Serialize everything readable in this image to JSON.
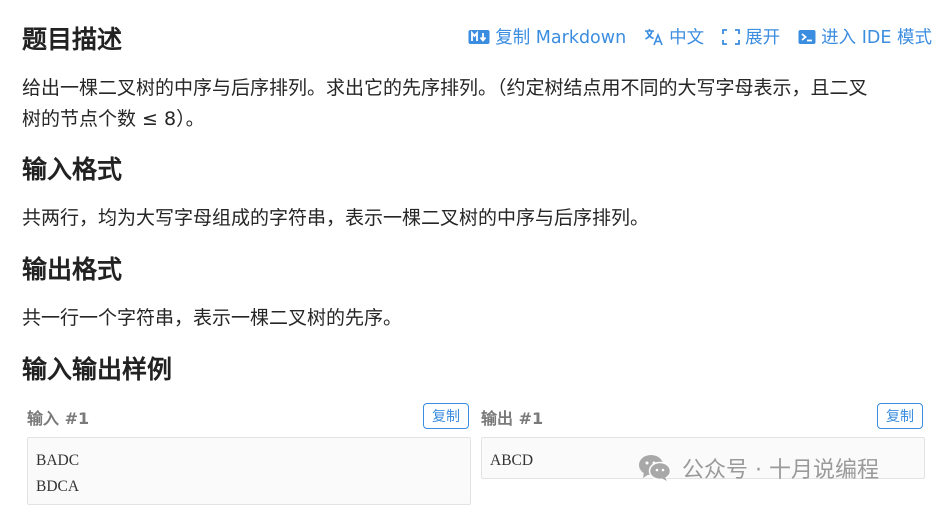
{
  "header": {
    "title": "题目描述",
    "actions": {
      "copy_markdown": "复制 Markdown",
      "language": "中文",
      "expand": "展开",
      "ide_mode": "进入 IDE 模式"
    }
  },
  "description": {
    "line1": "给出一棵二叉树的中序与后序排列。求出它的先序排列。（约定树结点用不同的大写字母表示，且二叉",
    "line2": "树的节点个数 ≤ 8）。"
  },
  "input_format": {
    "title": "输入格式",
    "text": "共两行，均为大写字母组成的字符串，表示一棵二叉树的中序与后序排列。"
  },
  "output_format": {
    "title": "输出格式",
    "text": "共一行一个字符串，表示一棵二叉树的先序。"
  },
  "samples": {
    "title": "输入输出样例",
    "input_label": "输入 #1",
    "output_label": "输出 #1",
    "copy_label": "复制",
    "input_lines": [
      "BADC",
      "BDCA"
    ],
    "output_lines": [
      "ABCD"
    ]
  },
  "watermark": {
    "text": "公众号 · 十月说编程"
  },
  "colors": {
    "accent": "#3b8de0",
    "heading": "#222222",
    "muted": "#7a7a7a"
  }
}
